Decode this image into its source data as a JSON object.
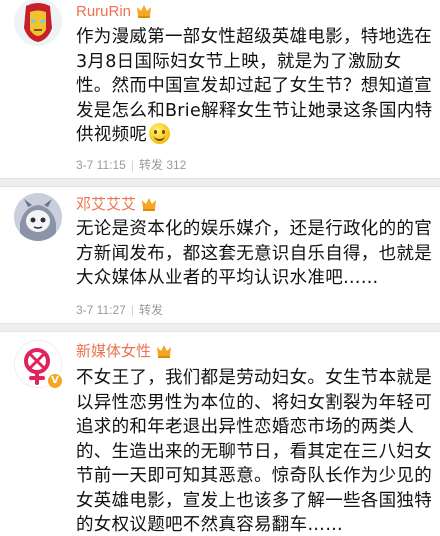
{
  "comments": [
    {
      "username": "RuruRin",
      "avatar_icon": "iron-man-icon",
      "text": "作为漫威第一部女性超级英雄电影，特地选在3月8日国际妇女节上映，就是为了激励女性。然而中国宣发却过起了女生节？想知道宣发是怎么和Brie解释女生节让她录这条国内特供视频呢",
      "time": "3-7 11:15",
      "repost_label": "转发",
      "repost_count": "312"
    },
    {
      "username": "邓艾艾艾",
      "avatar_icon": "cartoon-character-icon",
      "text": "无论是资本化的娱乐媒介，还是行政化的的官方新闻发布，都这套无意识自乐自得，也就是大众媒体从业者的平均认识水准吧……",
      "time": "3-7 11:27",
      "repost_label": "转发"
    },
    {
      "username": "新媒体女性",
      "avatar_icon": "female-symbol-logo-icon",
      "text": "不女王了，我们都是劳动妇女。女生节本就是以异性恋男性为本位的、将妇女割裂为年轻可追求的和年老退出异性恋婚恋市场的两类人的、生造出来的无聊节日，看其定在三八妇女节前一天即可知其恶意。惊奇队长作为少见的女英雄电影，宣发上也该多了解一些各国独特的女权议题吧不然真容易翻车……"
    }
  ],
  "colors": {
    "username": "#eb7350",
    "meta": "#9a9a9a",
    "divider": "#eeeeee",
    "verified_badge": "#f5a623"
  },
  "icons": [
    "vip-crown-icon",
    "verified-v-icon",
    "smile-emoji-icon"
  ]
}
